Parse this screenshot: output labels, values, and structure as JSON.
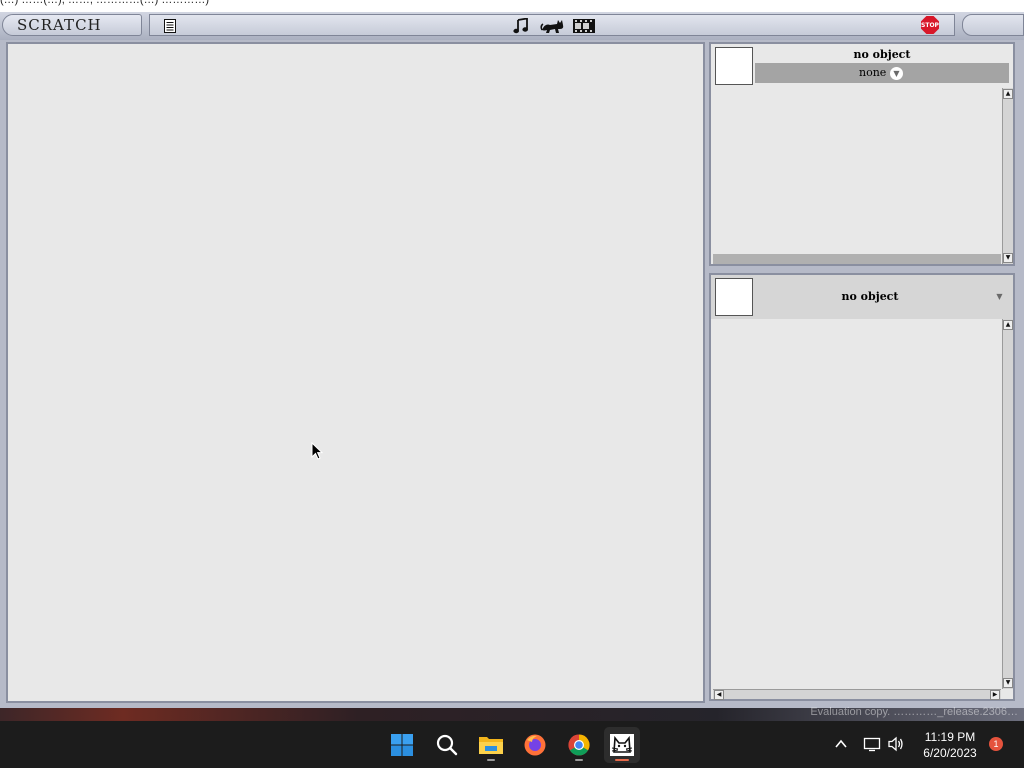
{
  "window_title_fragment": "(…) ……(…), ……, …………(…) …………)",
  "app": {
    "logo_text": "SCRATCH",
    "stop_label": "STOP",
    "toolbar_icons": [
      "document-icon",
      "music-note-icon",
      "cat-icon",
      "film-icon"
    ]
  },
  "sprite_panel": {
    "header": "no object",
    "selector": {
      "selected": "none"
    }
  },
  "script_panel": {
    "header": "no object"
  },
  "taskbar": {
    "watermark": "Evaluation copy. …………_release.2306…",
    "apps": [
      "start-icon",
      "search-icon",
      "file-explorer-icon",
      "firefox-icon",
      "chrome-icon",
      "scratch-icon"
    ],
    "time": "11:19 PM",
    "date": "6/20/2023",
    "notification_count": "1"
  },
  "colors": {
    "chrome": "#b6bac8",
    "stage": "#e8e8e8",
    "stop": "#d8182a",
    "taskbar": "#1c1c1c",
    "badge": "#e5533d"
  }
}
